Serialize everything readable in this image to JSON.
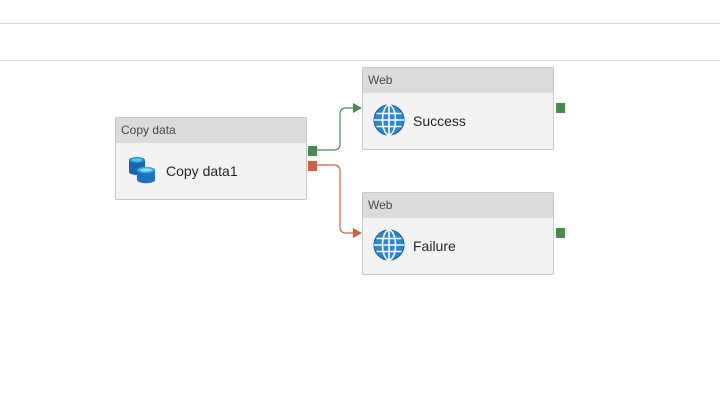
{
  "pipeline": {
    "activities": {
      "copy": {
        "type_label": "Copy data",
        "name": "Copy data1",
        "icon": "database-icon"
      },
      "success": {
        "type_label": "Web",
        "name": "Success",
        "icon": "globe-icon"
      },
      "failure": {
        "type_label": "Web",
        "name": "Failure",
        "icon": "globe-icon"
      }
    },
    "dependencies": [
      {
        "from": "Copy data1",
        "to": "Success",
        "condition": "Succeeded"
      },
      {
        "from": "Copy data1",
        "to": "Failure",
        "condition": "Failed"
      }
    ]
  },
  "colors": {
    "success": "#4a8a4f",
    "failure": "#d06040",
    "activity_header": "#dbdbdb",
    "activity_body": "#f3f3f3"
  }
}
